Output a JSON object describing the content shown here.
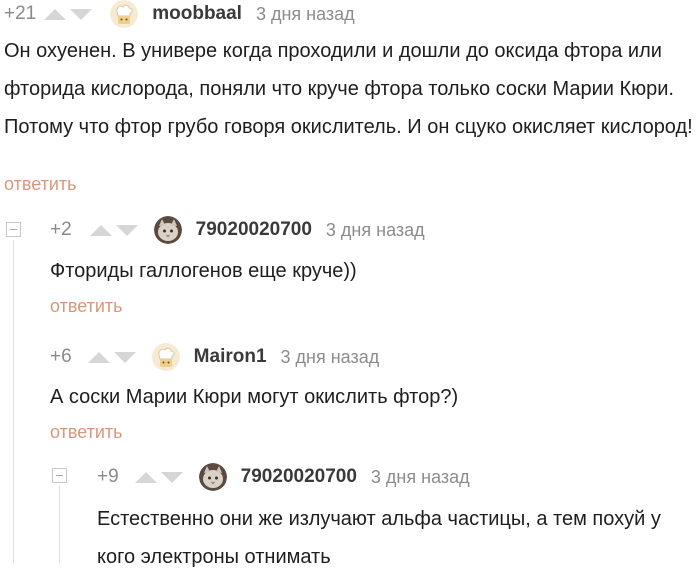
{
  "comments": [
    {
      "rating": "+21",
      "author": "moobbaal",
      "time": "3 дня назад",
      "text": "Он охуенен. В универе когда проходили и дошли до оксида фтора или фторида кислорода, поняли что круче фтора только соски Марии Кюри. Потому что фтор грубо говоря окислитель. И он сцуко окисляет кислород!",
      "reply_label": "ответить",
      "avatar_icon": "chef-avatar-icon"
    },
    {
      "rating": "+2",
      "author": "79020020700",
      "time": "3 дня назад",
      "text": "Фториды галлогенов еще круче))",
      "reply_label": "ответить",
      "avatar_icon": "cat-photo-avatar-icon"
    },
    {
      "rating": "+6",
      "author": "Mairon1",
      "time": "3 дня назад",
      "text": "А соски Марии Кюри могут окислить фтор?)",
      "reply_label": "ответить",
      "avatar_icon": "chef-avatar-icon"
    },
    {
      "rating": "+9",
      "author": "79020020700",
      "time": "3 дня назад",
      "text": "Естественно они же излучают альфа частицы, а тем похуй у кого электроны отнимать",
      "avatar_icon": "cat-photo-avatar-icon"
    }
  ],
  "colors": {
    "rating": "#8a8a8a",
    "vote_arrow": "#d6d6d6",
    "author": "#3a3a3a",
    "time": "#8c8c8c",
    "reply_link": "#d9977a",
    "tree_line": "#e0e0e0"
  }
}
